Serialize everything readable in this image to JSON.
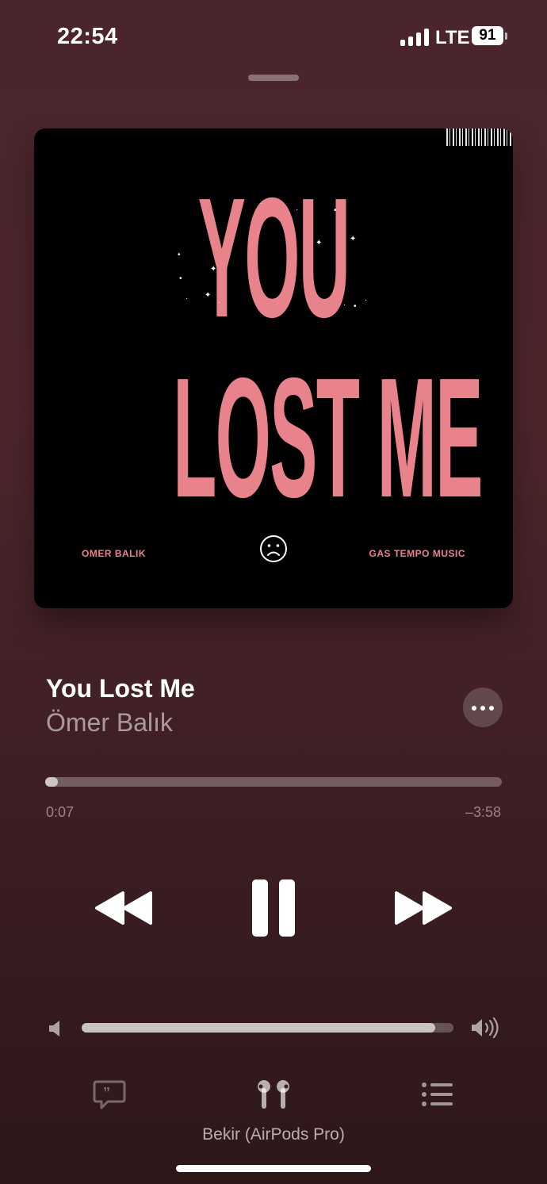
{
  "status_bar": {
    "time": "22:54",
    "network": "LTE",
    "battery": "91",
    "signal_bars": 4
  },
  "artwork": {
    "line1": "YOU",
    "line2": "LOST ME",
    "artist": "OMER BALIK",
    "label": "GAS TEMPO MUSIC"
  },
  "track": {
    "title": "You Lost Me",
    "artist": "Ömer Balık"
  },
  "playback": {
    "elapsed": "0:07",
    "remaining": "–3:58",
    "progress_fraction": 0.028,
    "state": "playing"
  },
  "volume": {
    "level_fraction": 0.95
  },
  "output": {
    "device": "Bekir (AirPods Pro)"
  },
  "icons": [
    "rewind-icon",
    "pause-icon",
    "fast-forward-icon",
    "speaker-low-icon",
    "speaker-high-icon",
    "lyrics-icon",
    "airpods-icon",
    "queue-icon",
    "more-icon"
  ]
}
